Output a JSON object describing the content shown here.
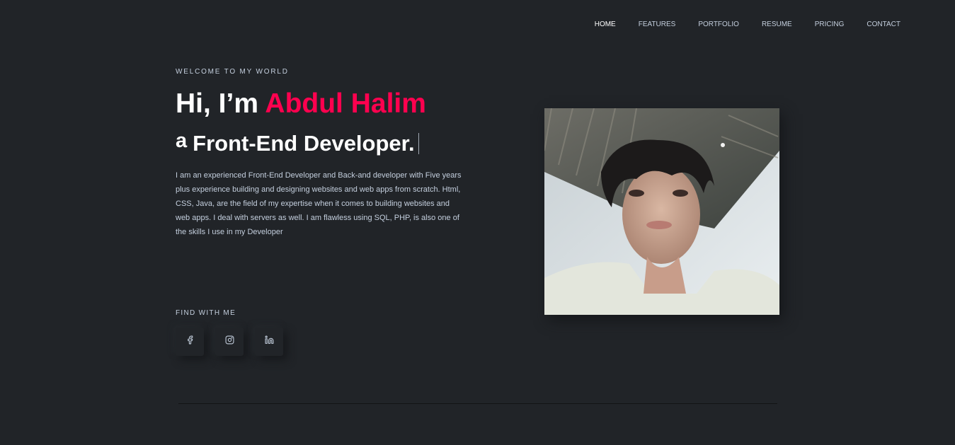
{
  "nav": {
    "items": [
      {
        "label": "HOME"
      },
      {
        "label": "FEATURES"
      },
      {
        "label": "PORTFOLIO"
      },
      {
        "label": "RESUME"
      },
      {
        "label": "PRICING"
      },
      {
        "label": "CONTACT"
      }
    ],
    "active": "HOME"
  },
  "hero": {
    "welcome": "WELCOME TO MY WORLD",
    "greeting": "Hi, I’m ",
    "name": "Abdul Halim",
    "sub_prefix": "a",
    "sub_role": "Front-End Developer.",
    "description": "I am an experienced Front-End Developer and Back-and developer with Five years plus experience building and designing websites and web apps from scratch. Html, CSS, Java, are the field of my expertise when it comes to building websites and web apps. I deal with servers as well. I am flawless using SQL, PHP, is also one of the skills I use in my Developer"
  },
  "find": {
    "label": "FIND WITH ME",
    "icons": [
      "facebook-icon",
      "instagram-icon",
      "linkedin-icon"
    ]
  },
  "colors": {
    "background": "#212428",
    "accent": "#ff014f",
    "text": "#c4cfde",
    "heading": "#ffffff"
  }
}
